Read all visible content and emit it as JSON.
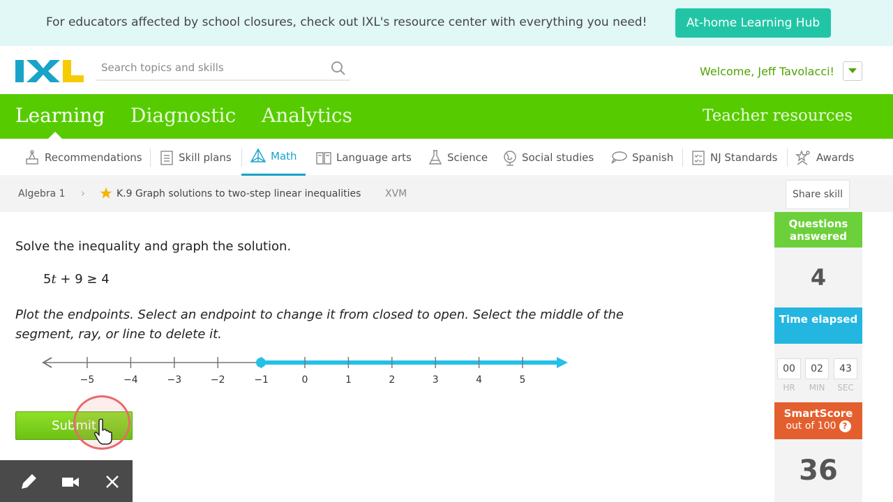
{
  "banner": {
    "text": "For educators affected by school closures, check out IXL's resource center with everything you need!",
    "button_label": "At-home Learning Hub"
  },
  "header": {
    "logo_text": "IXL",
    "search_placeholder": "Search topics and skills",
    "welcome": "Welcome, Jeff Tavolacci!"
  },
  "main_nav": {
    "items": [
      "Learning",
      "Diagnostic",
      "Analytics"
    ],
    "active": "Learning",
    "teacher_resources": "Teacher resources"
  },
  "subject_nav": {
    "items": [
      {
        "label": "Recommendations",
        "icon": "recommendations-icon"
      },
      {
        "label": "Skill plans",
        "icon": "skill-plans-icon"
      },
      {
        "label": "Math",
        "icon": "math-icon"
      },
      {
        "label": "Language arts",
        "icon": "book-icon"
      },
      {
        "label": "Science",
        "icon": "flask-icon"
      },
      {
        "label": "Social studies",
        "icon": "globe-icon"
      },
      {
        "label": "Spanish",
        "icon": "speech-bubble-icon"
      },
      {
        "label": "NJ Standards",
        "icon": "checklist-icon"
      },
      {
        "label": "Awards",
        "icon": "awards-icon"
      }
    ],
    "active": "Math"
  },
  "breadcrumb": {
    "course": "Algebra 1",
    "skill": "K.9 Graph solutions to two-step linear inequalities",
    "code": "XVM",
    "share_label": "Share skill"
  },
  "question": {
    "prompt": "Solve the inequality and graph the solution.",
    "eq_coef": "5",
    "eq_var": "t",
    "eq_rest": " + 9 ≥ 4",
    "instructions": "Plot the endpoints. Select an endpoint to change it from closed to open. Select the middle of the segment, ray, or line to delete it.",
    "number_line": {
      "ticks": [
        "−5",
        "−4",
        "−3",
        "−2",
        "−1",
        "0",
        "1",
        "2",
        "3",
        "4",
        "5"
      ],
      "ray_start": -1,
      "ray_direction": "right",
      "endpoint": "closed"
    },
    "submit_label": "Submit"
  },
  "sidebar": {
    "questions_label": "Questions answered",
    "questions_value": "4",
    "time_label": "Time elapsed",
    "time": {
      "hr": "00",
      "min": "02",
      "sec": "43"
    },
    "time_units": {
      "hr": "HR",
      "min": "MIN",
      "sec": "SEC"
    },
    "smartscore_label": "SmartScore",
    "smartscore_sub": "out of 100",
    "smartscore_value": "36"
  },
  "colors": {
    "brand_green": "#56cc00",
    "accent_blue": "#1aa3c9",
    "banner_bg": "#e1f8f7",
    "banner_button": "#21c5a6",
    "smartscore_red": "#e45f2e"
  }
}
